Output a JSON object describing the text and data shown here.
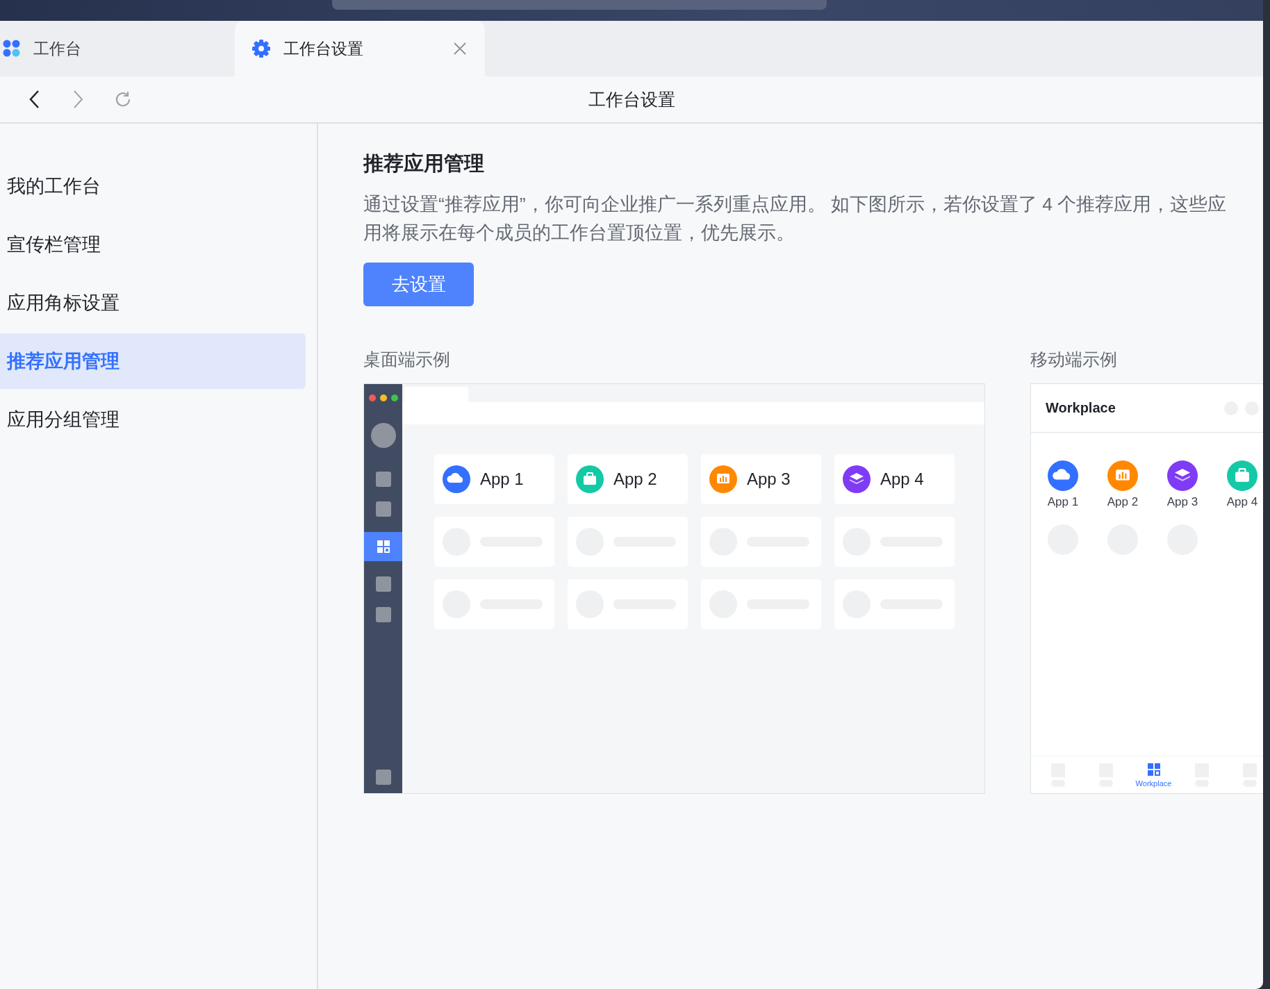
{
  "tabs": [
    {
      "label": "工作台",
      "selected": false,
      "kind": "apps"
    },
    {
      "label": "工作台设置",
      "selected": true,
      "kind": "gear"
    }
  ],
  "nav": {
    "title": "工作台设置"
  },
  "sidebar": {
    "items": [
      {
        "label": "我的工作台",
        "selected": false
      },
      {
        "label": "宣传栏管理",
        "selected": false
      },
      {
        "label": "应用角标设置",
        "selected": false
      },
      {
        "label": "推荐应用管理",
        "selected": true
      },
      {
        "label": "应用分组管理",
        "selected": false
      }
    ]
  },
  "section": {
    "title": "推荐应用管理",
    "description": [
      "通过设置“推荐应用”，你可向企业推广一系列重点应用。 如下图所示，若你设置了 4 个推荐应用，这些应",
      "用将展示在每个成员的工作台置顶位置，优先展示。"
    ],
    "button": "去设置"
  },
  "desktop_example": {
    "label": "桌面端示例",
    "apps": [
      {
        "name": "App 1",
        "kind": "cloud",
        "color": "#3370ff"
      },
      {
        "name": "App 2",
        "kind": "briefcase",
        "color": "#14c9a6"
      },
      {
        "name": "App 3",
        "kind": "chart",
        "color": "#ff8800"
      },
      {
        "name": "App 4",
        "kind": "layers",
        "color": "#7f3bf5"
      }
    ]
  },
  "mobile_example": {
    "label": "移动端示例",
    "title": "Workplace",
    "apps": [
      {
        "name": "App 1",
        "kind": "cloud",
        "color": "#3370ff"
      },
      {
        "name": "App 2",
        "kind": "chart",
        "color": "#ff8800"
      },
      {
        "name": "App 3",
        "kind": "layers",
        "color": "#7f3bf5"
      },
      {
        "name": "App 4",
        "kind": "briefcase",
        "color": "#14c9a6"
      }
    ],
    "tabbar": [
      {
        "selected": false
      },
      {
        "selected": false
      },
      {
        "selected": true,
        "label": "Workplace"
      },
      {
        "selected": false
      },
      {
        "selected": false
      }
    ]
  }
}
